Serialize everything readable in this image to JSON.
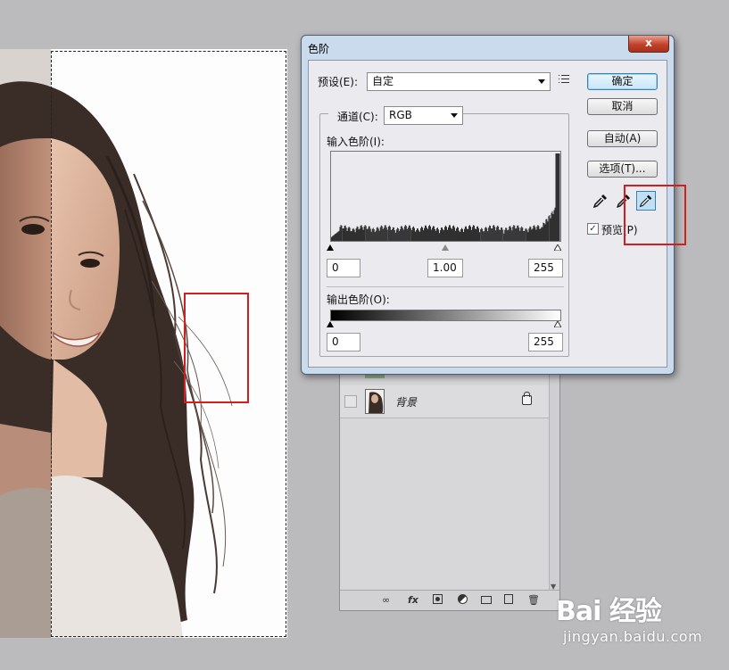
{
  "dialog": {
    "title": "色阶",
    "close_label": "x",
    "preset_label": "预设(E):",
    "preset_value": "自定",
    "channel_label": "通道(C):",
    "channel_value": "RGB",
    "input_levels_label": "输入色阶(I):",
    "input_black": "0",
    "input_mid": "1.00",
    "input_white": "255",
    "output_levels_label": "输出色阶(O):",
    "output_black": "0",
    "output_white": "255",
    "buttons": {
      "ok": "确定",
      "cancel": "取消",
      "auto": "自动(A)",
      "options": "选项(T)..."
    },
    "preview_label": "预览(P)",
    "preview_checked": true,
    "eyedroppers": [
      "black-point-eyedropper-icon",
      "gray-point-eyedropper-icon",
      "white-point-eyedropper-icon"
    ],
    "active_eyedropper": "white-point"
  },
  "layers_panel": {
    "layer_name": "背景",
    "footer_icons": [
      "link-icon",
      "fx-icon",
      "mask-icon",
      "adjustment-icon",
      "folder-icon",
      "new-layer-icon",
      "trash-icon"
    ],
    "fx_label": "fx"
  },
  "colors": {
    "highlight_box": "#d11e1e",
    "dialog_frame": "#c9dbec",
    "workspace": "#bbbabd"
  },
  "watermark": {
    "logo": "Bai 经验",
    "url": "jingyan.baidu.com"
  }
}
